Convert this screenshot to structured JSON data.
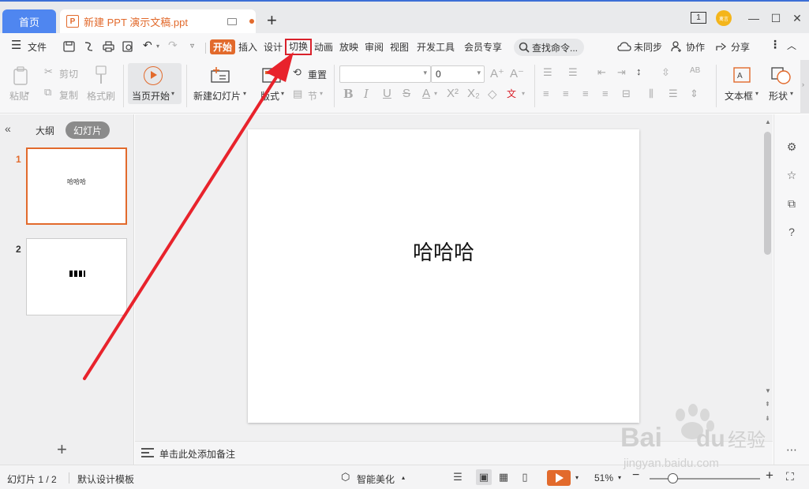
{
  "titlebar": {
    "home_tab": "首页",
    "doc_tab": "新建 PPT 演示文稿.ppt",
    "doc_icon_letter": "P",
    "new_tab": "+",
    "window_badge": "1",
    "avatar_text": "禽言",
    "minimize": "—",
    "maximize": "☐",
    "close": "✕"
  },
  "menubar": {
    "file": "文件",
    "tabs": [
      "开始",
      "插入",
      "设计",
      "切换",
      "动画",
      "放映",
      "审阅",
      "视图",
      "开发工具",
      "会员专享"
    ],
    "search_placeholder": "查找命令...",
    "sync": "未同步",
    "collab": "协作",
    "share": "分享"
  },
  "ribbon": {
    "paste": "粘贴",
    "cut": "剪切",
    "copy": "复制",
    "format_painter": "格式刷",
    "from_current": "当页开始",
    "new_slide": "新建幻灯片",
    "layout": "版式",
    "reset": "重置",
    "section": "节",
    "font_size": "0",
    "textbox": "文本框",
    "shapes": "形状"
  },
  "left_panel": {
    "outline_tab": "大纲",
    "slides_tab": "幻灯片",
    "slides": [
      {
        "num": "1",
        "text": "哈哈哈"
      },
      {
        "num": "2",
        "text": ""
      }
    ],
    "add": "+"
  },
  "slide": {
    "text": "哈哈哈"
  },
  "notes": {
    "placeholder": "单击此处添加备注"
  },
  "statusbar": {
    "slide_count": "幻灯片 1 / 2",
    "template": "默认设计模板",
    "beautify": "智能美化",
    "zoom": "51%",
    "zoom_minus": "−",
    "zoom_plus": "+"
  },
  "watermark": {
    "brand": "Bai du 经验",
    "url": "jingyan.baidu.com"
  },
  "colors": {
    "accent_orange": "#e26a2c",
    "home_tab_blue": "#4f86f0",
    "highlight_red": "#d9212b"
  }
}
